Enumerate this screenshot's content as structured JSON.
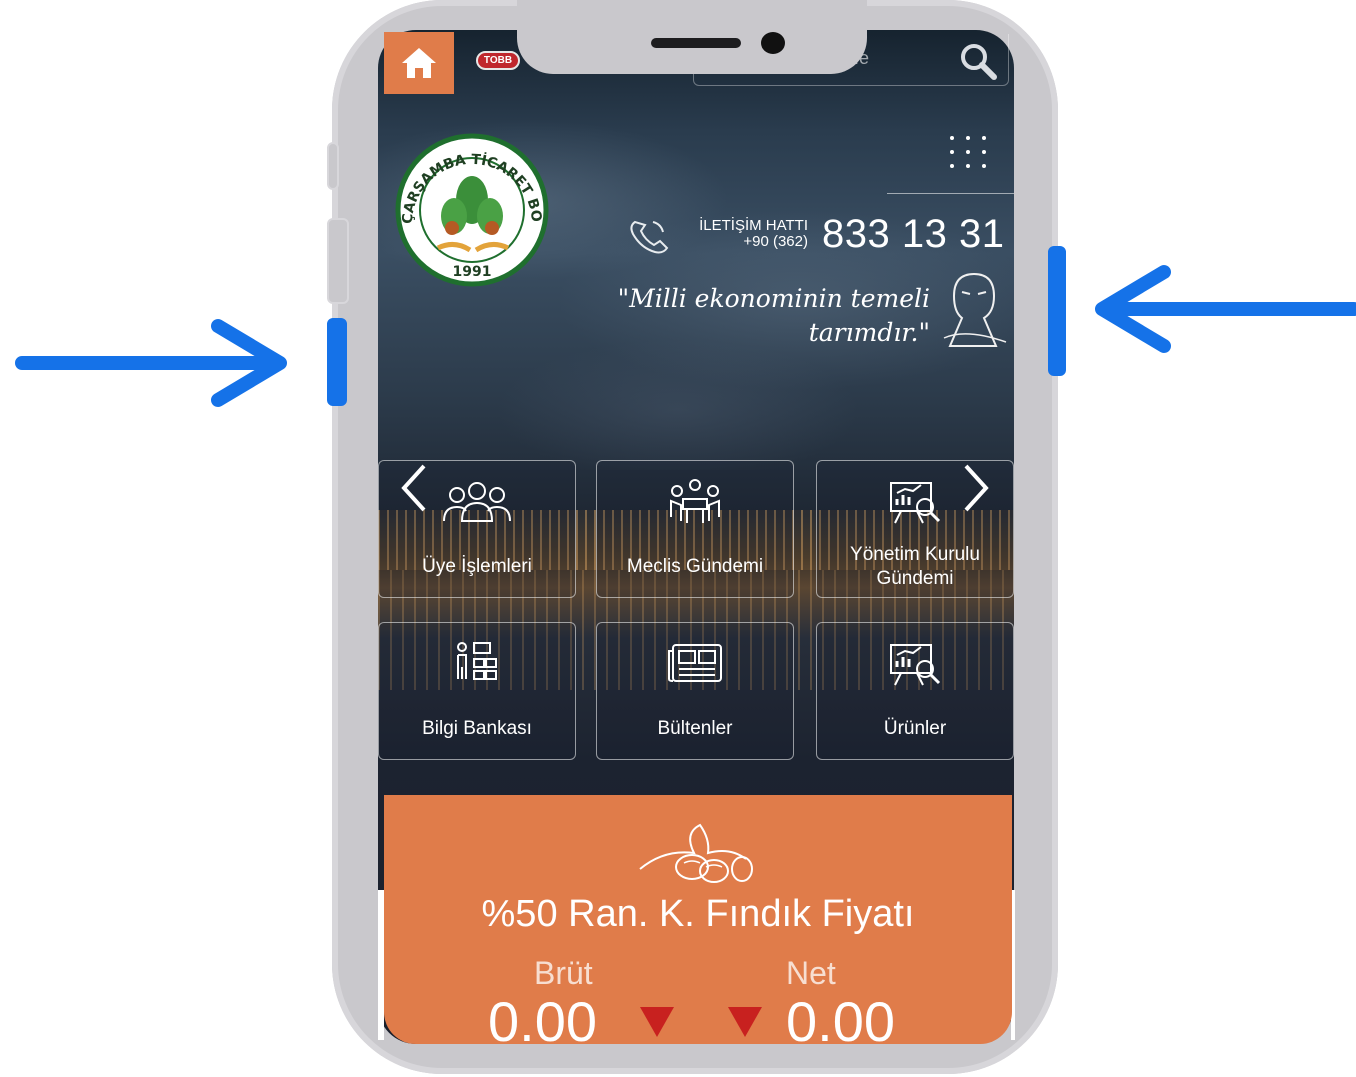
{
  "header": {
    "search_placeholder": "Ara...",
    "search_placeholder_visible": "ıe",
    "tobb_logo": "TOBB"
  },
  "logo": {
    "name": "ÇARŞAMBA TİCARET BORSASI",
    "year": "1991"
  },
  "contact": {
    "label": "İLETİŞİM HATTI",
    "area_code": "+90 (362)",
    "number": "833 13 31"
  },
  "quote": {
    "line1": "\"Milli ekonominin temeli",
    "line2": "tarımdır.\""
  },
  "tiles": [
    {
      "label": "Üye İşlemleri",
      "icon": "group-users-icon"
    },
    {
      "label": "Meclis Gündemi",
      "icon": "meeting-icon"
    },
    {
      "label": "Yönetim Kurulu Gündemi",
      "line1": "Yönetim Kurulu",
      "line2": "Gündemi",
      "icon": "presentation-chart-icon"
    },
    {
      "label": "Bilgi Bankası",
      "icon": "knowledge-icon"
    },
    {
      "label": "Bültenler",
      "icon": "newspaper-icon"
    },
    {
      "label": "Ürünler",
      "icon": "presentation-chart-icon"
    }
  ],
  "price": {
    "title": "%50 Ran. K. Fındık Fiyatı",
    "brut_label": "Brüt",
    "net_label": "Net",
    "brut_value": "0.00",
    "net_value": "0.00",
    "trend": "down"
  },
  "colors": {
    "accent": "#e07c4a",
    "arrow_blue": "#1572e8",
    "trend_down": "#c8211f",
    "frame": "#c9c8cc"
  }
}
